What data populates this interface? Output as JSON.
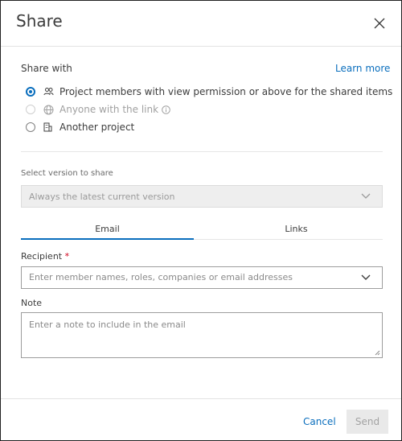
{
  "dialog": {
    "title": "Share"
  },
  "share_with": {
    "label": "Share with",
    "learn_more": "Learn more",
    "options": [
      {
        "label": "Project members with view permission or above for the shared items",
        "icon": "people-icon",
        "state": "selected"
      },
      {
        "label": "Anyone with the link",
        "icon": "globe-icon",
        "state": "disabled"
      },
      {
        "label": "Another project",
        "icon": "building-icon",
        "state": "unselected"
      }
    ]
  },
  "version": {
    "label": "Select version to share",
    "value": "Always the latest current version"
  },
  "tabs": [
    {
      "label": "Email",
      "active": true
    },
    {
      "label": "Links",
      "active": false
    }
  ],
  "recipient": {
    "label": "Recipient",
    "required_mark": "*",
    "placeholder": "Enter member names, roles, companies or email addresses"
  },
  "note": {
    "label": "Note",
    "placeholder": "Enter a note to include in the email"
  },
  "footer": {
    "cancel": "Cancel",
    "send": "Send"
  },
  "colors": {
    "accent": "#0a6ebd",
    "required": "#d0021b",
    "disabled_bg": "#e9e9e9"
  }
}
